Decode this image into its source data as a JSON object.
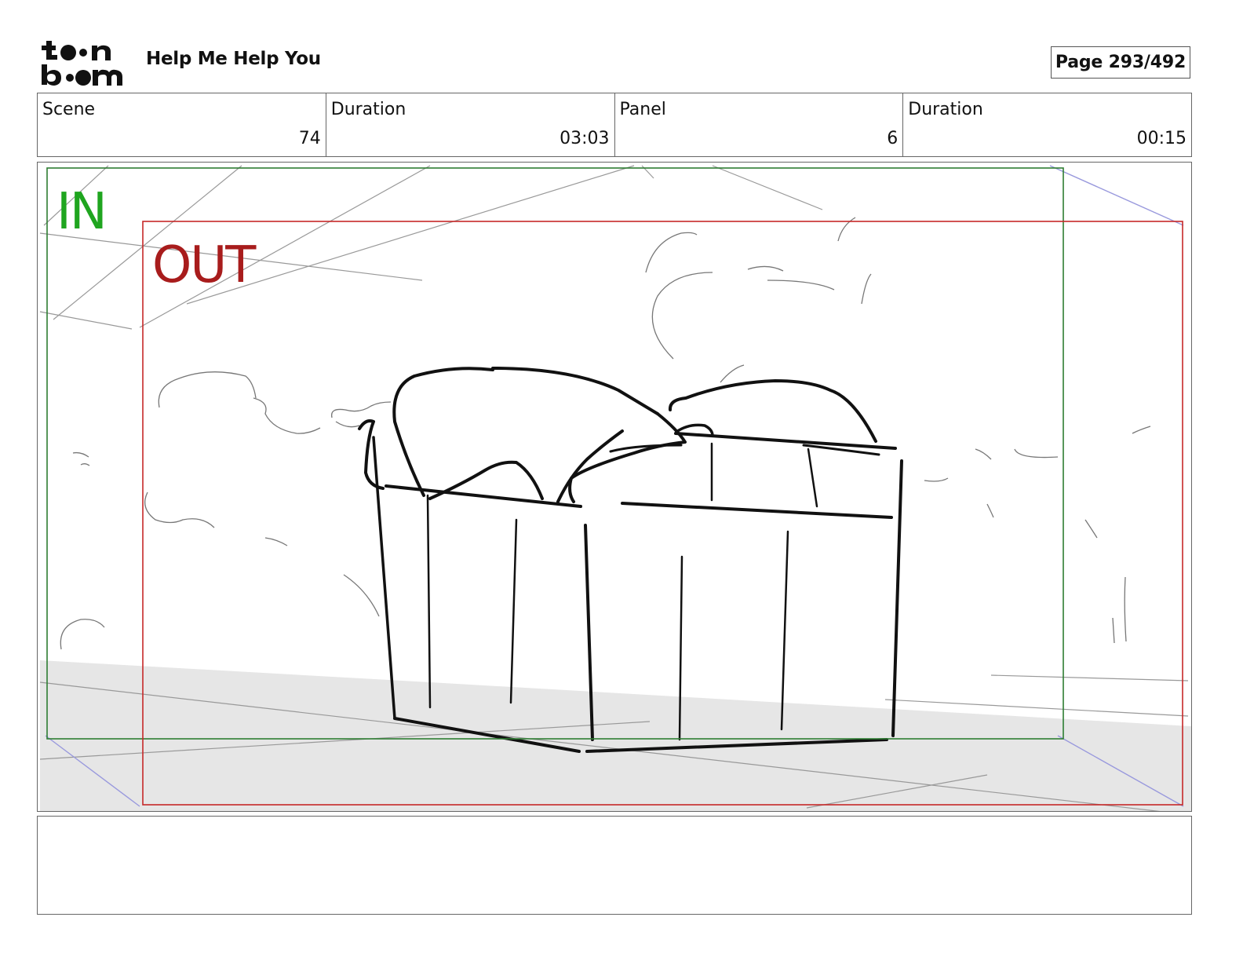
{
  "header": {
    "logo": {
      "line1": "toon",
      "line2": "boom"
    },
    "project_title": "Help Me Help You",
    "page_label": "Page 293/492"
  },
  "info": {
    "scene_label": "Scene",
    "scene_value": "74",
    "scene_duration_label": "Duration",
    "scene_duration_value": "03:03",
    "panel_label": "Panel",
    "panel_value": "6",
    "panel_duration_label": "Duration",
    "panel_duration_value": "00:15"
  },
  "panel": {
    "in_label": "IN",
    "out_label": "OUT",
    "colors": {
      "in_frame": "#2e7d32",
      "in_text": "#1fa51f",
      "out_frame": "#c62828",
      "out_text": "#a81c1c",
      "floor": "#e6e6e6"
    }
  },
  "notes": {
    "text": ""
  }
}
